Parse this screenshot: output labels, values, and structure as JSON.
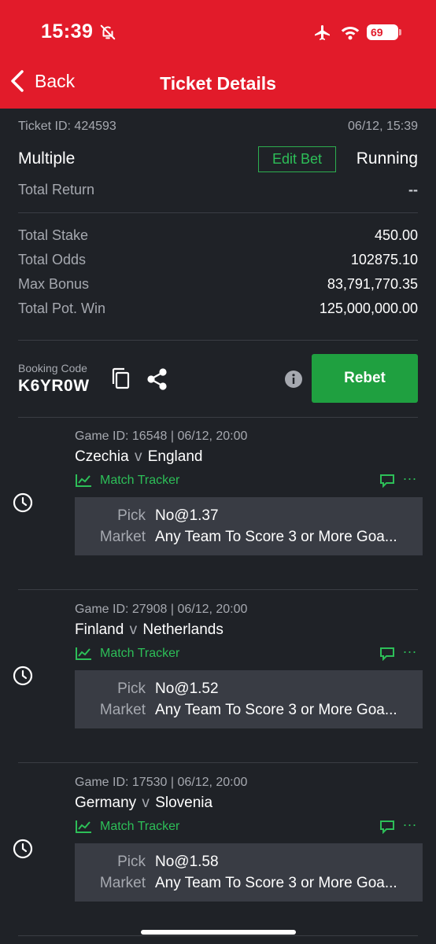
{
  "status": {
    "time": "15:39",
    "battery": "69"
  },
  "header": {
    "back_label": "Back",
    "title": "Ticket Details"
  },
  "ticket": {
    "id_label": "Ticket ID: 424593",
    "datetime": "06/12, 15:39",
    "type": "Multiple",
    "edit_label": "Edit Bet",
    "status": "Running",
    "total_return_label": "Total Return",
    "total_return_value": "--",
    "total_stake_label": "Total Stake",
    "total_stake_value": "450.00",
    "total_odds_label": "Total Odds",
    "total_odds_value": "102875.10",
    "max_bonus_label": "Max Bonus",
    "max_bonus_value": "83,791,770.35",
    "total_pot_win_label": "Total Pot. Win",
    "total_pot_win_value": "125,000,000.00"
  },
  "booking": {
    "label": "Booking Code",
    "code": "K6YR0W",
    "rebet_label": "Rebet"
  },
  "games": [
    {
      "game_id": "Game ID: 16548 | 06/12, 20:00",
      "home": "Czechia",
      "vs": "v",
      "away": "England",
      "tracker_label": "Match Tracker",
      "pick_label": "Pick",
      "pick_value": "No@1.37",
      "market_label": "Market",
      "market_value": "Any Team To Score 3 or More Goa..."
    },
    {
      "game_id": "Game ID: 27908 | 06/12, 20:00",
      "home": "Finland",
      "vs": "v",
      "away": "Netherlands",
      "tracker_label": "Match Tracker",
      "pick_label": "Pick",
      "pick_value": "No@1.52",
      "market_label": "Market",
      "market_value": "Any Team To Score 3 or More Goa..."
    },
    {
      "game_id": "Game ID: 17530 | 06/12, 20:00",
      "home": "Germany",
      "vs": "v",
      "away": "Slovenia",
      "tracker_label": "Match Tracker",
      "pick_label": "Pick",
      "pick_value": "No@1.58",
      "market_label": "Market",
      "market_value": "Any Team To Score 3 or More Goa..."
    }
  ],
  "colors": {
    "header_bg": "#e21b2a",
    "page_bg": "#1f2227",
    "accent_green": "#2dbf58",
    "button_green": "#1fa040"
  },
  "icons": [
    "bell-off-icon",
    "airplane-icon",
    "wifi-icon",
    "chevron-left-icon",
    "copy-icon",
    "share-icon",
    "info-icon",
    "clock-icon",
    "chart-line-icon",
    "chat-icon",
    "more-icon"
  ]
}
